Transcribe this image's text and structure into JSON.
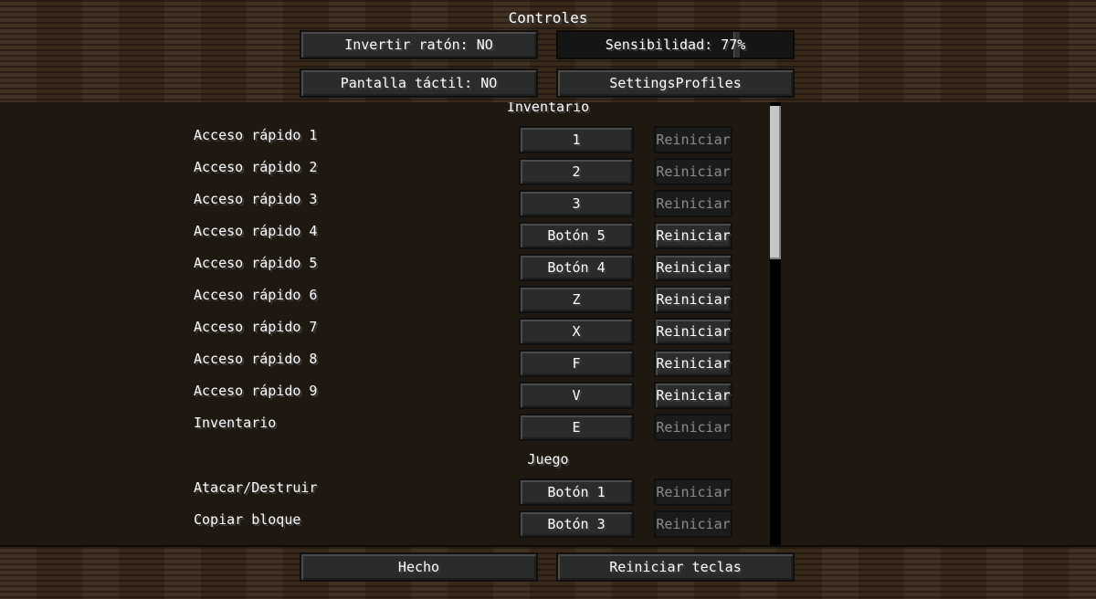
{
  "title": "Controles",
  "options": {
    "invert_mouse": "Invertir ratón: NO",
    "sensitivity": "Sensibilidad: 77%",
    "sensitivity_value": 0.77,
    "touchscreen": "Pantalla táctil: NO",
    "settings_profiles": "SettingsProfiles"
  },
  "sections": [
    {
      "title": "Inventario",
      "rows": [
        {
          "label": "Acceso rápido 1",
          "key": "1",
          "reset": "Reiniciar",
          "reset_enabled": false
        },
        {
          "label": "Acceso rápido 2",
          "key": "2",
          "reset": "Reiniciar",
          "reset_enabled": false
        },
        {
          "label": "Acceso rápido 3",
          "key": "3",
          "reset": "Reiniciar",
          "reset_enabled": false
        },
        {
          "label": "Acceso rápido 4",
          "key": "Botón 5",
          "reset": "Reiniciar",
          "reset_enabled": true
        },
        {
          "label": "Acceso rápido 5",
          "key": "Botón 4",
          "reset": "Reiniciar",
          "reset_enabled": true
        },
        {
          "label": "Acceso rápido 6",
          "key": "Z",
          "reset": "Reiniciar",
          "reset_enabled": true
        },
        {
          "label": "Acceso rápido 7",
          "key": "X",
          "reset": "Reiniciar",
          "reset_enabled": true
        },
        {
          "label": "Acceso rápido 8",
          "key": "F",
          "reset": "Reiniciar",
          "reset_enabled": true
        },
        {
          "label": "Acceso rápido 9",
          "key": "V",
          "reset": "Reiniciar",
          "reset_enabled": true
        },
        {
          "label": "Inventario",
          "key": "E",
          "reset": "Reiniciar",
          "reset_enabled": false
        }
      ]
    },
    {
      "title": "Juego",
      "rows": [
        {
          "label": "Atacar/Destruir",
          "key": "Botón 1",
          "reset": "Reiniciar",
          "reset_enabled": false
        },
        {
          "label": "Copiar bloque",
          "key": "Botón 3",
          "reset": "Reiniciar",
          "reset_enabled": false
        }
      ]
    }
  ],
  "footer": {
    "done": "Hecho",
    "reset_keys": "Reiniciar teclas"
  }
}
